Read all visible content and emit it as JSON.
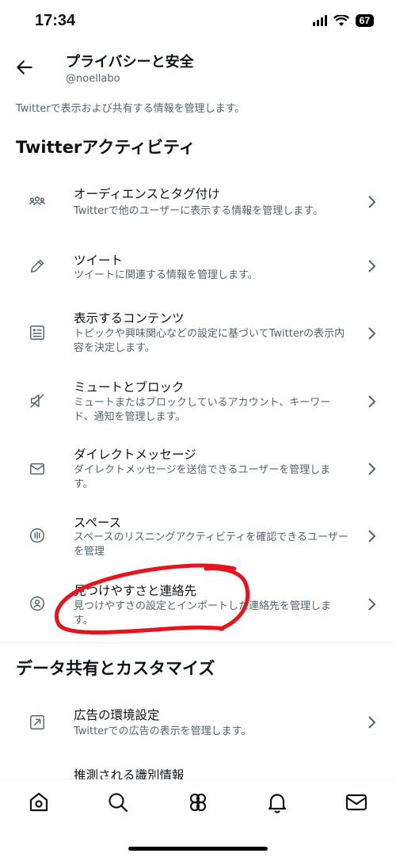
{
  "status": {
    "time": "17:34",
    "battery": "67"
  },
  "header": {
    "title": "プライバシーと安全",
    "handle": "@noellabo"
  },
  "description": "Twitterで表示および共有する情報を管理します。",
  "sections": [
    {
      "title": "Twitterアクティビティ"
    },
    {
      "title": "データ共有とカスタマイズ"
    }
  ],
  "items": [
    {
      "title": "オーディエンスとタグ付け",
      "sub": "Twitterで他のユーザーに表示する情報を管理します。"
    },
    {
      "title": "ツイート",
      "sub": "ツイートに関連する情報を管理します。"
    },
    {
      "title": "表示するコンテンツ",
      "sub": "トピックや興味関心などの設定に基づいてTwitterの表示内容を決定します。"
    },
    {
      "title": "ミュートとブロック",
      "sub": "ミュートまたはブロックしているアカウント、キーワード、通知を管理します。"
    },
    {
      "title": "ダイレクトメッセージ",
      "sub": "ダイレクトメッセージを送信できるユーザーを管理します。"
    },
    {
      "title": "スペース",
      "sub": "スペースのリスニングアクティビティを確認できるユーザーを管理"
    },
    {
      "title": "見つけやすさと連絡先",
      "sub": "見つけやすさの設定とインポートした連絡先を管理します。"
    },
    {
      "title": "広告の環境設定",
      "sub": "Twitterでの広告の表示を管理します。"
    },
    {
      "title": "推測される識別情報"
    }
  ],
  "annotation_color": "#e8141d"
}
